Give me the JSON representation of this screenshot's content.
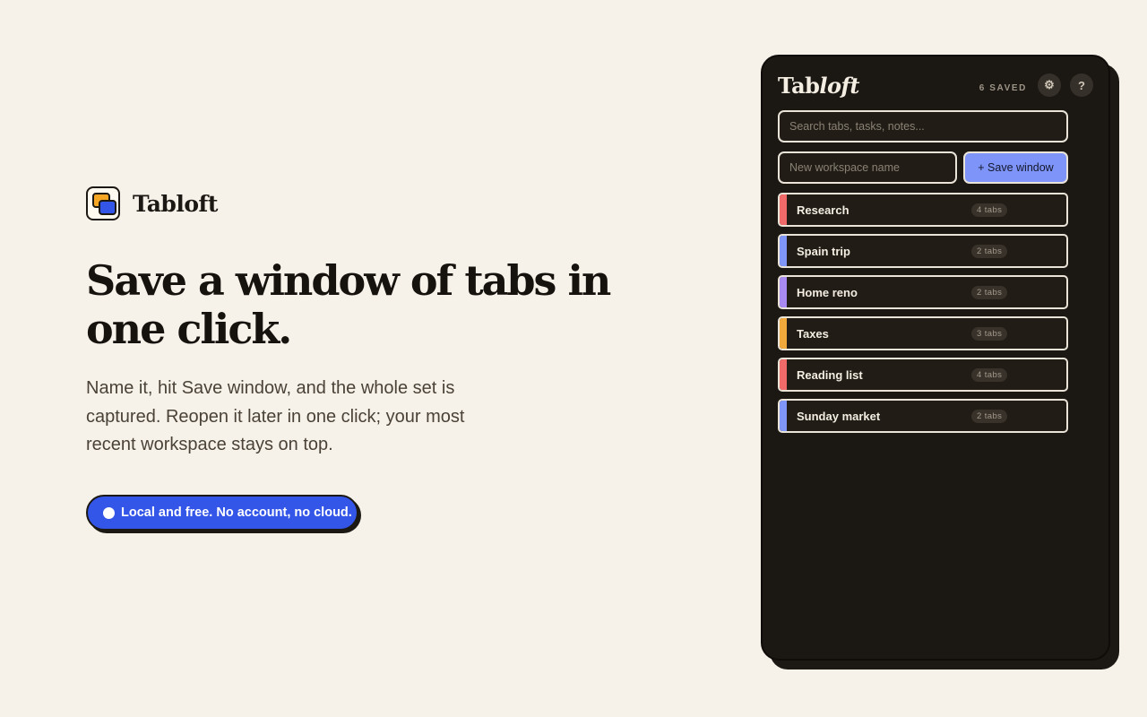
{
  "brand": {
    "name": "Tabloft",
    "colors": {
      "logo_back": "#f5a623",
      "logo_front": "#3355e8"
    }
  },
  "hero": {
    "title": "Save a window of tabs in one click.",
    "subtitle": "Name it, hit Save window, and the whole set is captured. Reopen it later in one click; your most recent workspace stays on top.",
    "pill": "Local and free. No account, no cloud."
  },
  "app": {
    "logo_plain": "Tab",
    "logo_italic": "loft",
    "saved_count": "6 SAVED",
    "settings_icon": "gear-icon",
    "help_icon": "help-icon",
    "settings_glyph": "⚙",
    "help_glyph": "?",
    "search": {
      "placeholder": "Search tabs, tasks, notes..."
    },
    "new_workspace": {
      "placeholder": "New workspace name",
      "button_label": "+ Save window"
    },
    "workspaces": [
      {
        "name": "Research",
        "count": "4 tabs",
        "color": "#f06a6a"
      },
      {
        "name": "Spain trip",
        "count": "2 tabs",
        "color": "#7f95f7"
      },
      {
        "name": "Home reno",
        "count": "2 tabs",
        "color": "#a98af3"
      },
      {
        "name": "Taxes",
        "count": "3 tabs",
        "color": "#f2a93b"
      },
      {
        "name": "Reading list",
        "count": "4 tabs",
        "color": "#f06a6a"
      },
      {
        "name": "Sunday market",
        "count": "2 tabs",
        "color": "#7f95f7"
      }
    ],
    "colors": {
      "accent": "#7e94f8",
      "panel": "#1b1712"
    }
  }
}
